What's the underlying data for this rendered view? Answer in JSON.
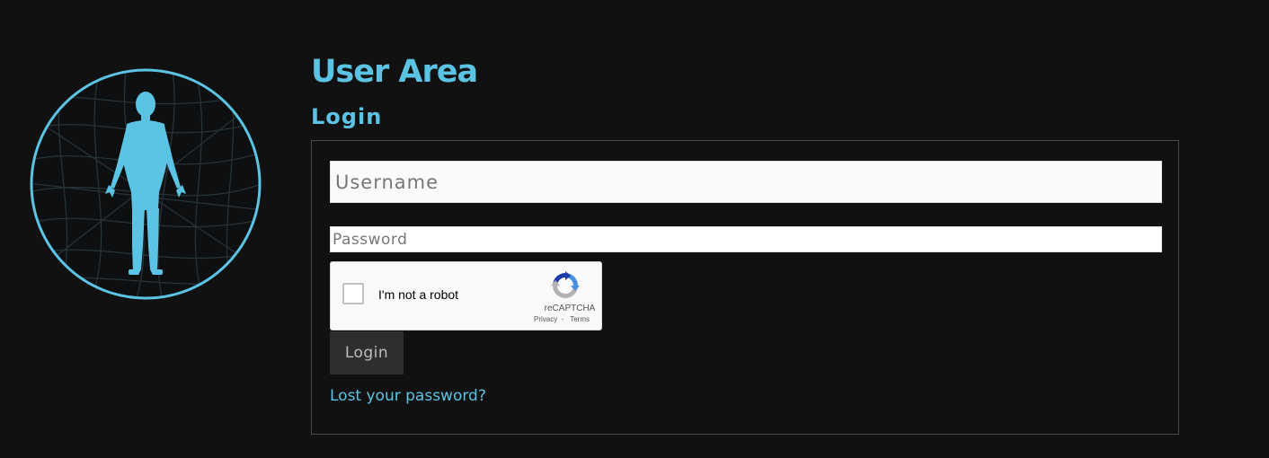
{
  "header": {
    "title": "User Area",
    "subtitle": "Login"
  },
  "logo": {
    "icon": "human-figure-globe-icon",
    "accent_color": "#5bc4e4"
  },
  "form": {
    "username_placeholder": "Username",
    "password_placeholder": "Password",
    "submit_label": "Login",
    "lost_password_label": "Lost your password?"
  },
  "recaptcha": {
    "checkbox_label": "I'm not a robot",
    "checked": false,
    "brand": "reCAPTCHA",
    "privacy_label": "Privacy",
    "separator": "-",
    "terms_label": "Terms",
    "icon": "recaptcha-logo-icon"
  },
  "colors": {
    "background": "#111111",
    "accent": "#5bc4e4",
    "button_bg": "#2e2e2e",
    "box_border": "#4a4a4a"
  }
}
